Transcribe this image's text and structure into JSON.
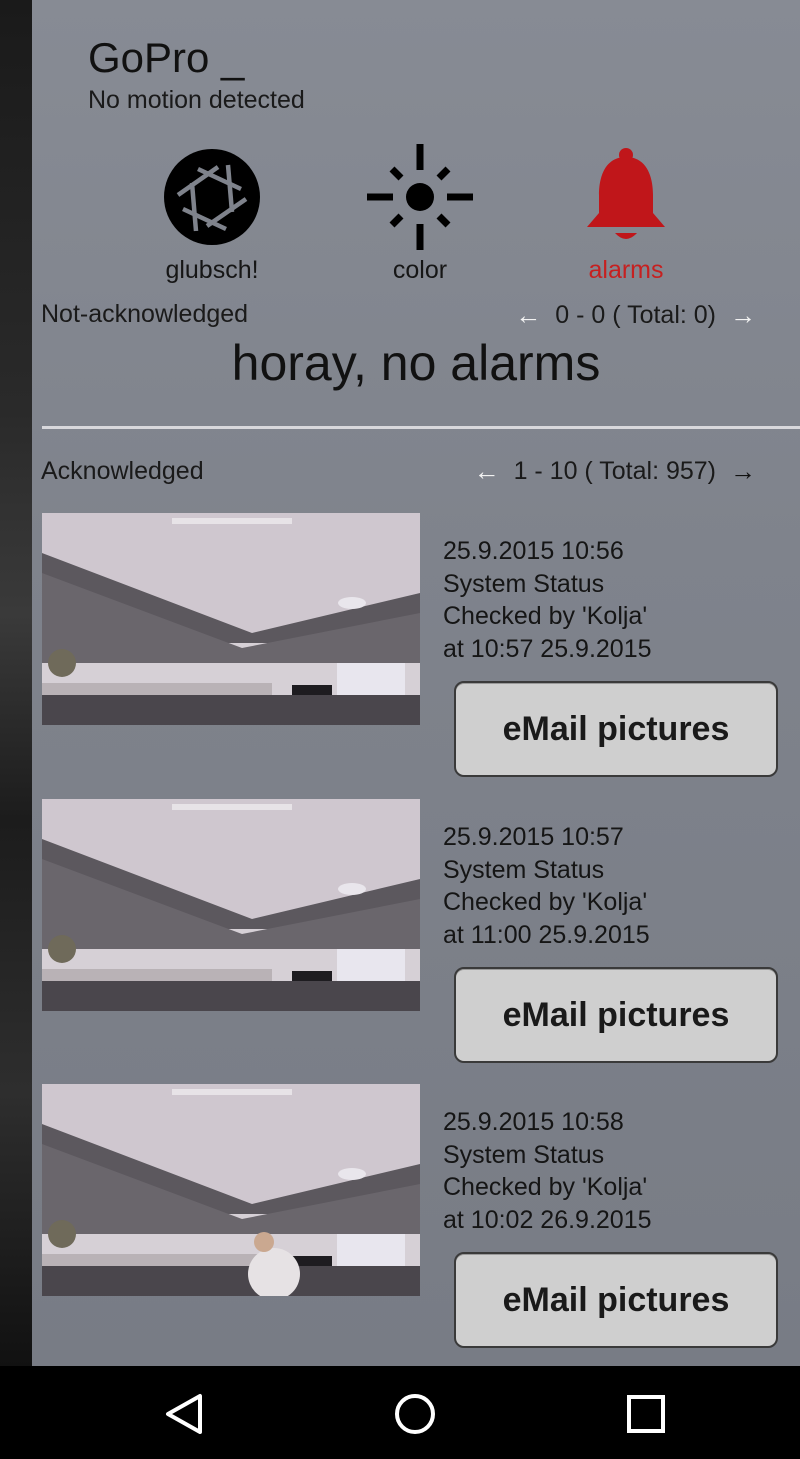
{
  "device": {
    "title": "GoPro _",
    "status": "No motion detected"
  },
  "actions": [
    {
      "label": "glubsch!",
      "icon": "camera-aperture-icon"
    },
    {
      "label": "color",
      "icon": "brightness-icon"
    },
    {
      "label": "alarms",
      "icon": "bell-icon",
      "active_color": "#c62020"
    }
  ],
  "not_acknowledged": {
    "label": "Not-acknowledged",
    "pager": "0 - 0 ( Total: 0)",
    "empty_message": "horay, no alarms"
  },
  "acknowledged": {
    "label": "Acknowledged",
    "pager": "1 - 10 ( Total: 957)"
  },
  "events": [
    {
      "datetime": "25.9.2015 10:56",
      "type": "System Status",
      "checked_by": "Checked by 'Kolja'",
      "checked_at": "at 10:57 25.9.2015",
      "button": "eMail pictures"
    },
    {
      "datetime": "25.9.2015 10:57",
      "type": "System Status",
      "checked_by": "Checked by 'Kolja'",
      "checked_at": "at 11:00 25.9.2015",
      "button": "eMail pictures"
    },
    {
      "datetime": "25.9.2015 10:58",
      "type": "System Status",
      "checked_by": "Checked by 'Kolja'",
      "checked_at": "at 10:02 26.9.2015",
      "button": "eMail pictures"
    }
  ],
  "colors": {
    "background": "#7f838c",
    "accent_alarm": "#c62020",
    "button": "#cfcfcf"
  }
}
